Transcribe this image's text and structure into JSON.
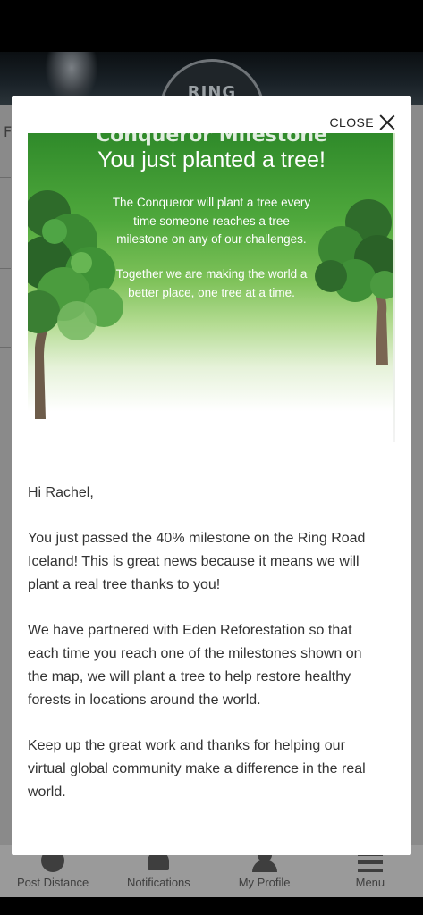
{
  "header": {
    "logo_text": "RING"
  },
  "background": {
    "partial_letter": "F"
  },
  "modal": {
    "close_label": "CLOSE",
    "banner": {
      "partial_title": "Conqueror Milestone",
      "title": "You just planted a tree!",
      "paragraph1": "The Conqueror will plant a tree every time someone reaches a tree milestone on any of our challenges.",
      "paragraph2": "Together we are making the world a better place, one tree at a time."
    },
    "body": {
      "greeting": "Hi Rachel,",
      "paragraph1": "You just passed the 40% milestone on the Ring Road Iceland! This is great news because it means we will plant a real tree thanks to you!",
      "paragraph2": "We have partnered with Eden Reforestation so that each time you reach one of the milestones shown on the map, we will plant a tree to help restore healthy forests in locations around the world.",
      "paragraph3": "Keep up the great work and thanks for helping our virtual global community make a difference in the real world."
    }
  },
  "bottom_nav": {
    "items": [
      {
        "label": "Post Distance",
        "icon": "plus-circle-icon"
      },
      {
        "label": "Notifications",
        "icon": "bell-icon"
      },
      {
        "label": "My Profile",
        "icon": "person-icon"
      },
      {
        "label": "Menu",
        "icon": "menu-icon"
      }
    ]
  },
  "colors": {
    "banner_green": "#4fa83c",
    "overlay_gray": "#8a8a8a",
    "text_dark": "#333333"
  }
}
